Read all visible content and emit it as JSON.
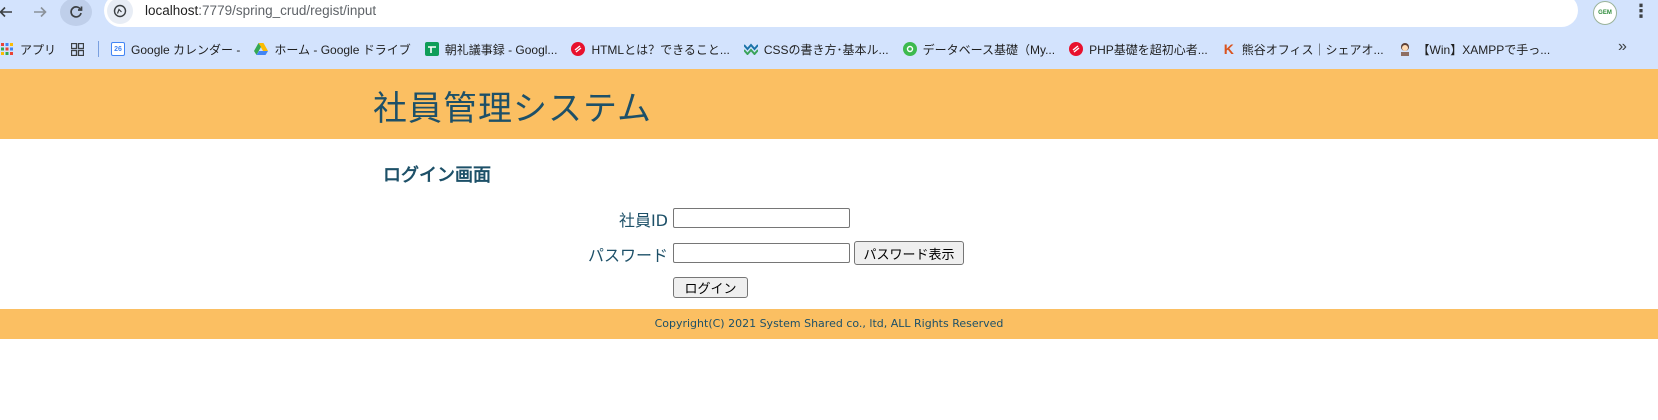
{
  "browser": {
    "url_host": "localhost",
    "url_rest": ":7779/spring_crud/regist/input",
    "profile_text": "GEM",
    "bookmarks": [
      {
        "label": "アプリ",
        "icon": "apps-grid-icon",
        "color": "#e8453c"
      },
      {
        "label": "Google カレンダー -",
        "icon": "google-calendar-icon",
        "color": "#4285f4",
        "badge": "26"
      },
      {
        "label": "ホーム - Google ドライブ",
        "icon": "google-drive-icon",
        "color": "#34a853"
      },
      {
        "label": "朝礼議事録 - Googl...",
        "icon": "google-sheets-icon",
        "color": "#0f9d58"
      },
      {
        "label": "HTMLとは？できること...",
        "icon": "red-circle-icon",
        "color": "#e8112d"
      },
      {
        "label": "CSSの書き方･基本ル...",
        "icon": "blue-diamond-icon",
        "color": "#1a73a8"
      },
      {
        "label": "データベース基礎（My...",
        "icon": "green-circle-icon",
        "color": "#3dba4e"
      },
      {
        "label": "PHP基礎を超初心者...",
        "icon": "red-circle-icon",
        "color": "#e8112d"
      },
      {
        "label": "熊谷オフィス｜シェアオ...",
        "icon": "k-logo-icon",
        "color": "#d9531e"
      },
      {
        "label": "【Win】XAMPPで手っ...",
        "icon": "avatar-icon",
        "color": "#8d6e63"
      }
    ]
  },
  "header": {
    "title": "社員管理システム"
  },
  "login": {
    "heading": "ログイン画面",
    "employee_id_label": "社員ID",
    "employee_id_value": "",
    "password_label": "パスワード",
    "password_value": "",
    "show_password_button": "パスワード表示",
    "login_button": "ログイン"
  },
  "footer": {
    "copyright": "Copyright(C) 2021 System Shared co., ltd, ALL Rights Reserved"
  },
  "colors": {
    "accent": "#fbbf62",
    "text_primary": "#1d5068",
    "chrome": "#d3e3fd"
  }
}
